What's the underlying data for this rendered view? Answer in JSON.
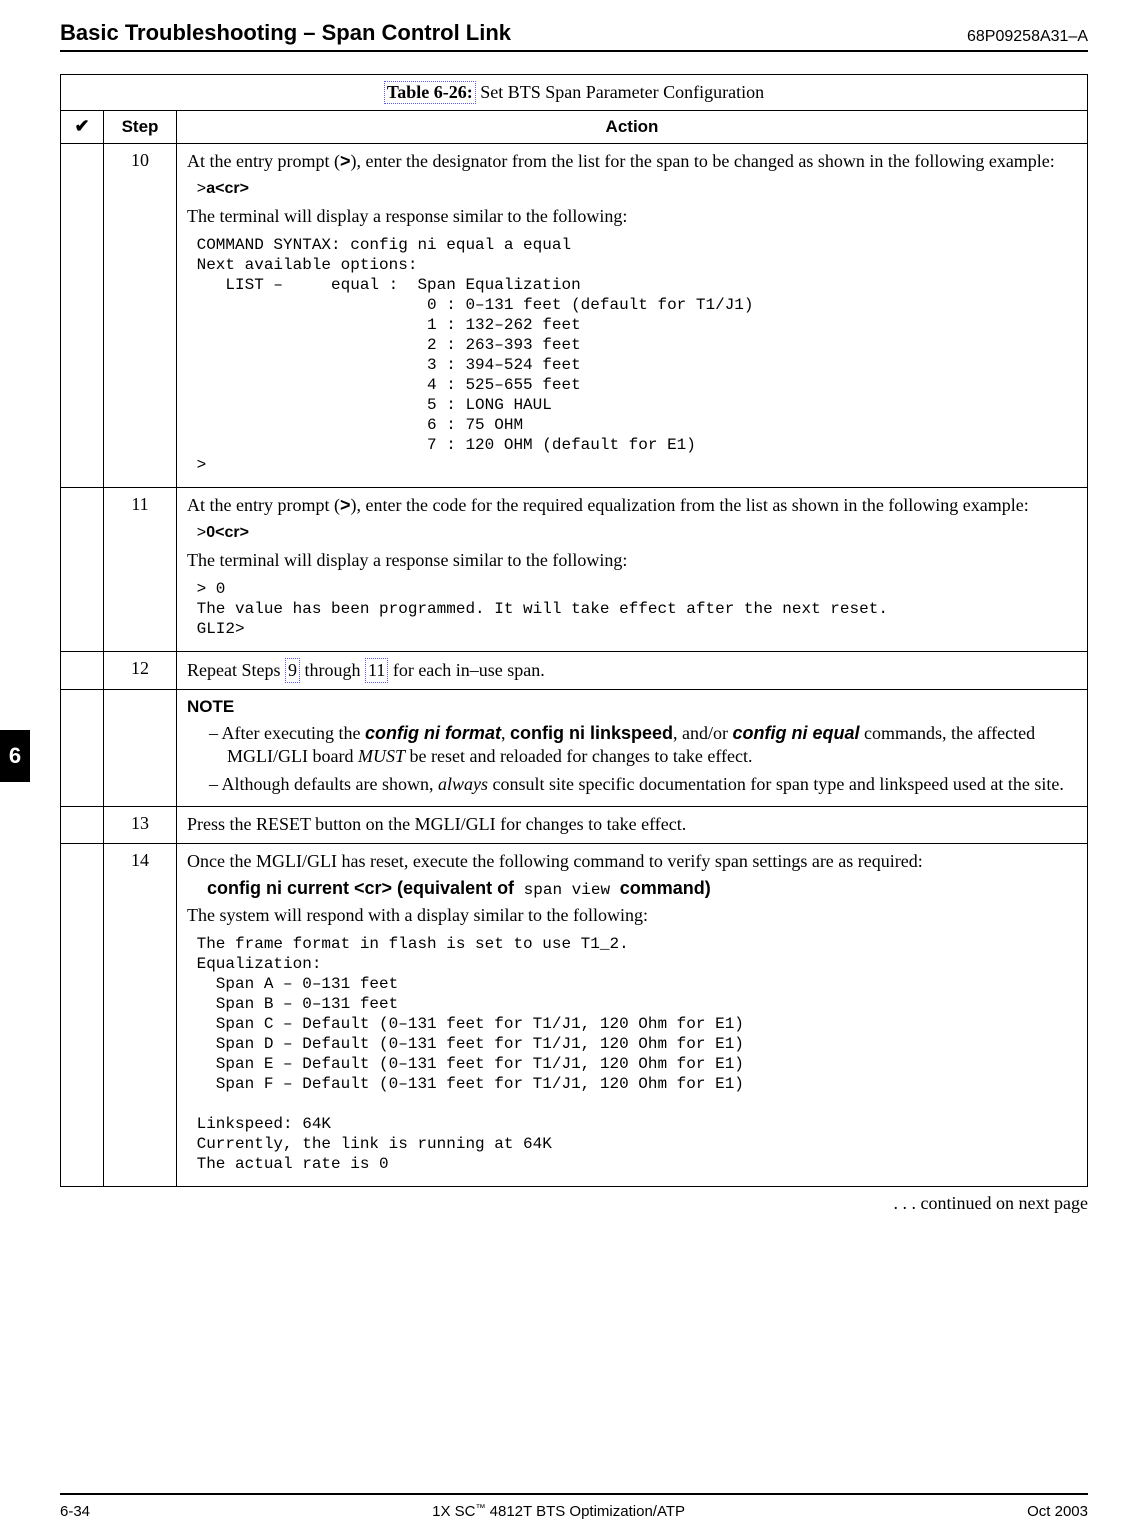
{
  "header": {
    "title": "Basic Troubleshooting – Span Control Link",
    "doc_number": "68P09258A31–A"
  },
  "side_tab": "6",
  "table": {
    "title_label": "Table 6-26:",
    "title_rest": " Set BTS Span Parameter Configuration",
    "head_check": "✔",
    "head_step": "Step",
    "head_action": "Action"
  },
  "rows": {
    "r10": {
      "step": "10",
      "p1a": "At the entry prompt (",
      "p1b": "), enter the designator from the list for the span to be changed as shown in the following example:",
      "gt": ">",
      "cmd_prefix": " >",
      "cmd": "a<cr>",
      "p2": "The terminal will display a response similar to the following:",
      "out": " COMMAND SYNTAX: config ni equal a equal\n Next available options:\n    LIST –     equal :  Span Equalization\n                         0 : 0–131 feet (default for T1/J1)\n                         1 : 132–262 feet\n                         2 : 263–393 feet\n                         3 : 394–524 feet\n                         4 : 525–655 feet\n                         5 : LONG HAUL\n                         6 : 75 OHM\n                         7 : 120 OHM (default for E1)\n >"
    },
    "r11": {
      "step": "11",
      "p1a": "At the entry prompt (",
      "p1b": "), enter the code for the required equalization from the list as shown in the following example:",
      "gt": ">",
      "cmd_prefix": " >",
      "cmd": "0<cr>",
      "p2": "The terminal will display a response similar to the following:",
      "out": " > 0\n The value has been programmed. It will take effect after the next reset.\n GLI2>"
    },
    "r12": {
      "step": "12",
      "t1": "Repeat Steps ",
      "link9": "9",
      "t2": " through ",
      "link11": "11",
      "t3": " for each in–use span."
    },
    "rnote": {
      "head": "NOTE",
      "li1a": "After executing the ",
      "li1_cmd1": "config  ni  format",
      "li1b": ", ",
      "li1_cmd2": "config ni linkspeed",
      "li1c": ", and/or ",
      "li1_cmd3": "config  ni  equal",
      "li1d": " commands, the affected MGLI/GLI board ",
      "li1_must": "MUST",
      "li1e": " be reset and reloaded for changes to take effect.",
      "li2a": "Although defaults are shown, ",
      "li2_always": "always",
      "li2b": " consult site specific documentation for span type and linkspeed used at the site."
    },
    "r13": {
      "step": "13",
      "text": "Press the RESET button on the MGLI/GLI for changes to take effect."
    },
    "r14": {
      "step": "14",
      "p1": "Once the MGLI/GLI has reset, execute the following command to verify span settings are as required:",
      "cmd_b": "config ni current  <cr>  (equivalent of",
      "cmd_mono": " span view ",
      "cmd_b2": "command)",
      "p2": "The system will respond with a display similar to the following:",
      "out": " The frame format in flash is set to use T1_2.\n Equalization:\n   Span A – 0–131 feet\n   Span B – 0–131 feet\n   Span C – Default (0–131 feet for T1/J1, 120 Ohm for E1)\n   Span D – Default (0–131 feet for T1/J1, 120 Ohm for E1)\n   Span E – Default (0–131 feet for T1/J1, 120 Ohm for E1)\n   Span F – Default (0–131 feet for T1/J1, 120 Ohm for E1)\n\n Linkspeed: 64K\n Currently, the link is running at 64K\n The actual rate is 0"
    }
  },
  "continued": " . . . continued on next page",
  "footer": {
    "left": "6-34",
    "center_a": "1X SC",
    "center_tm": "™",
    "center_b": " 4812T BTS Optimization/ATP",
    "right": "Oct 2003"
  }
}
